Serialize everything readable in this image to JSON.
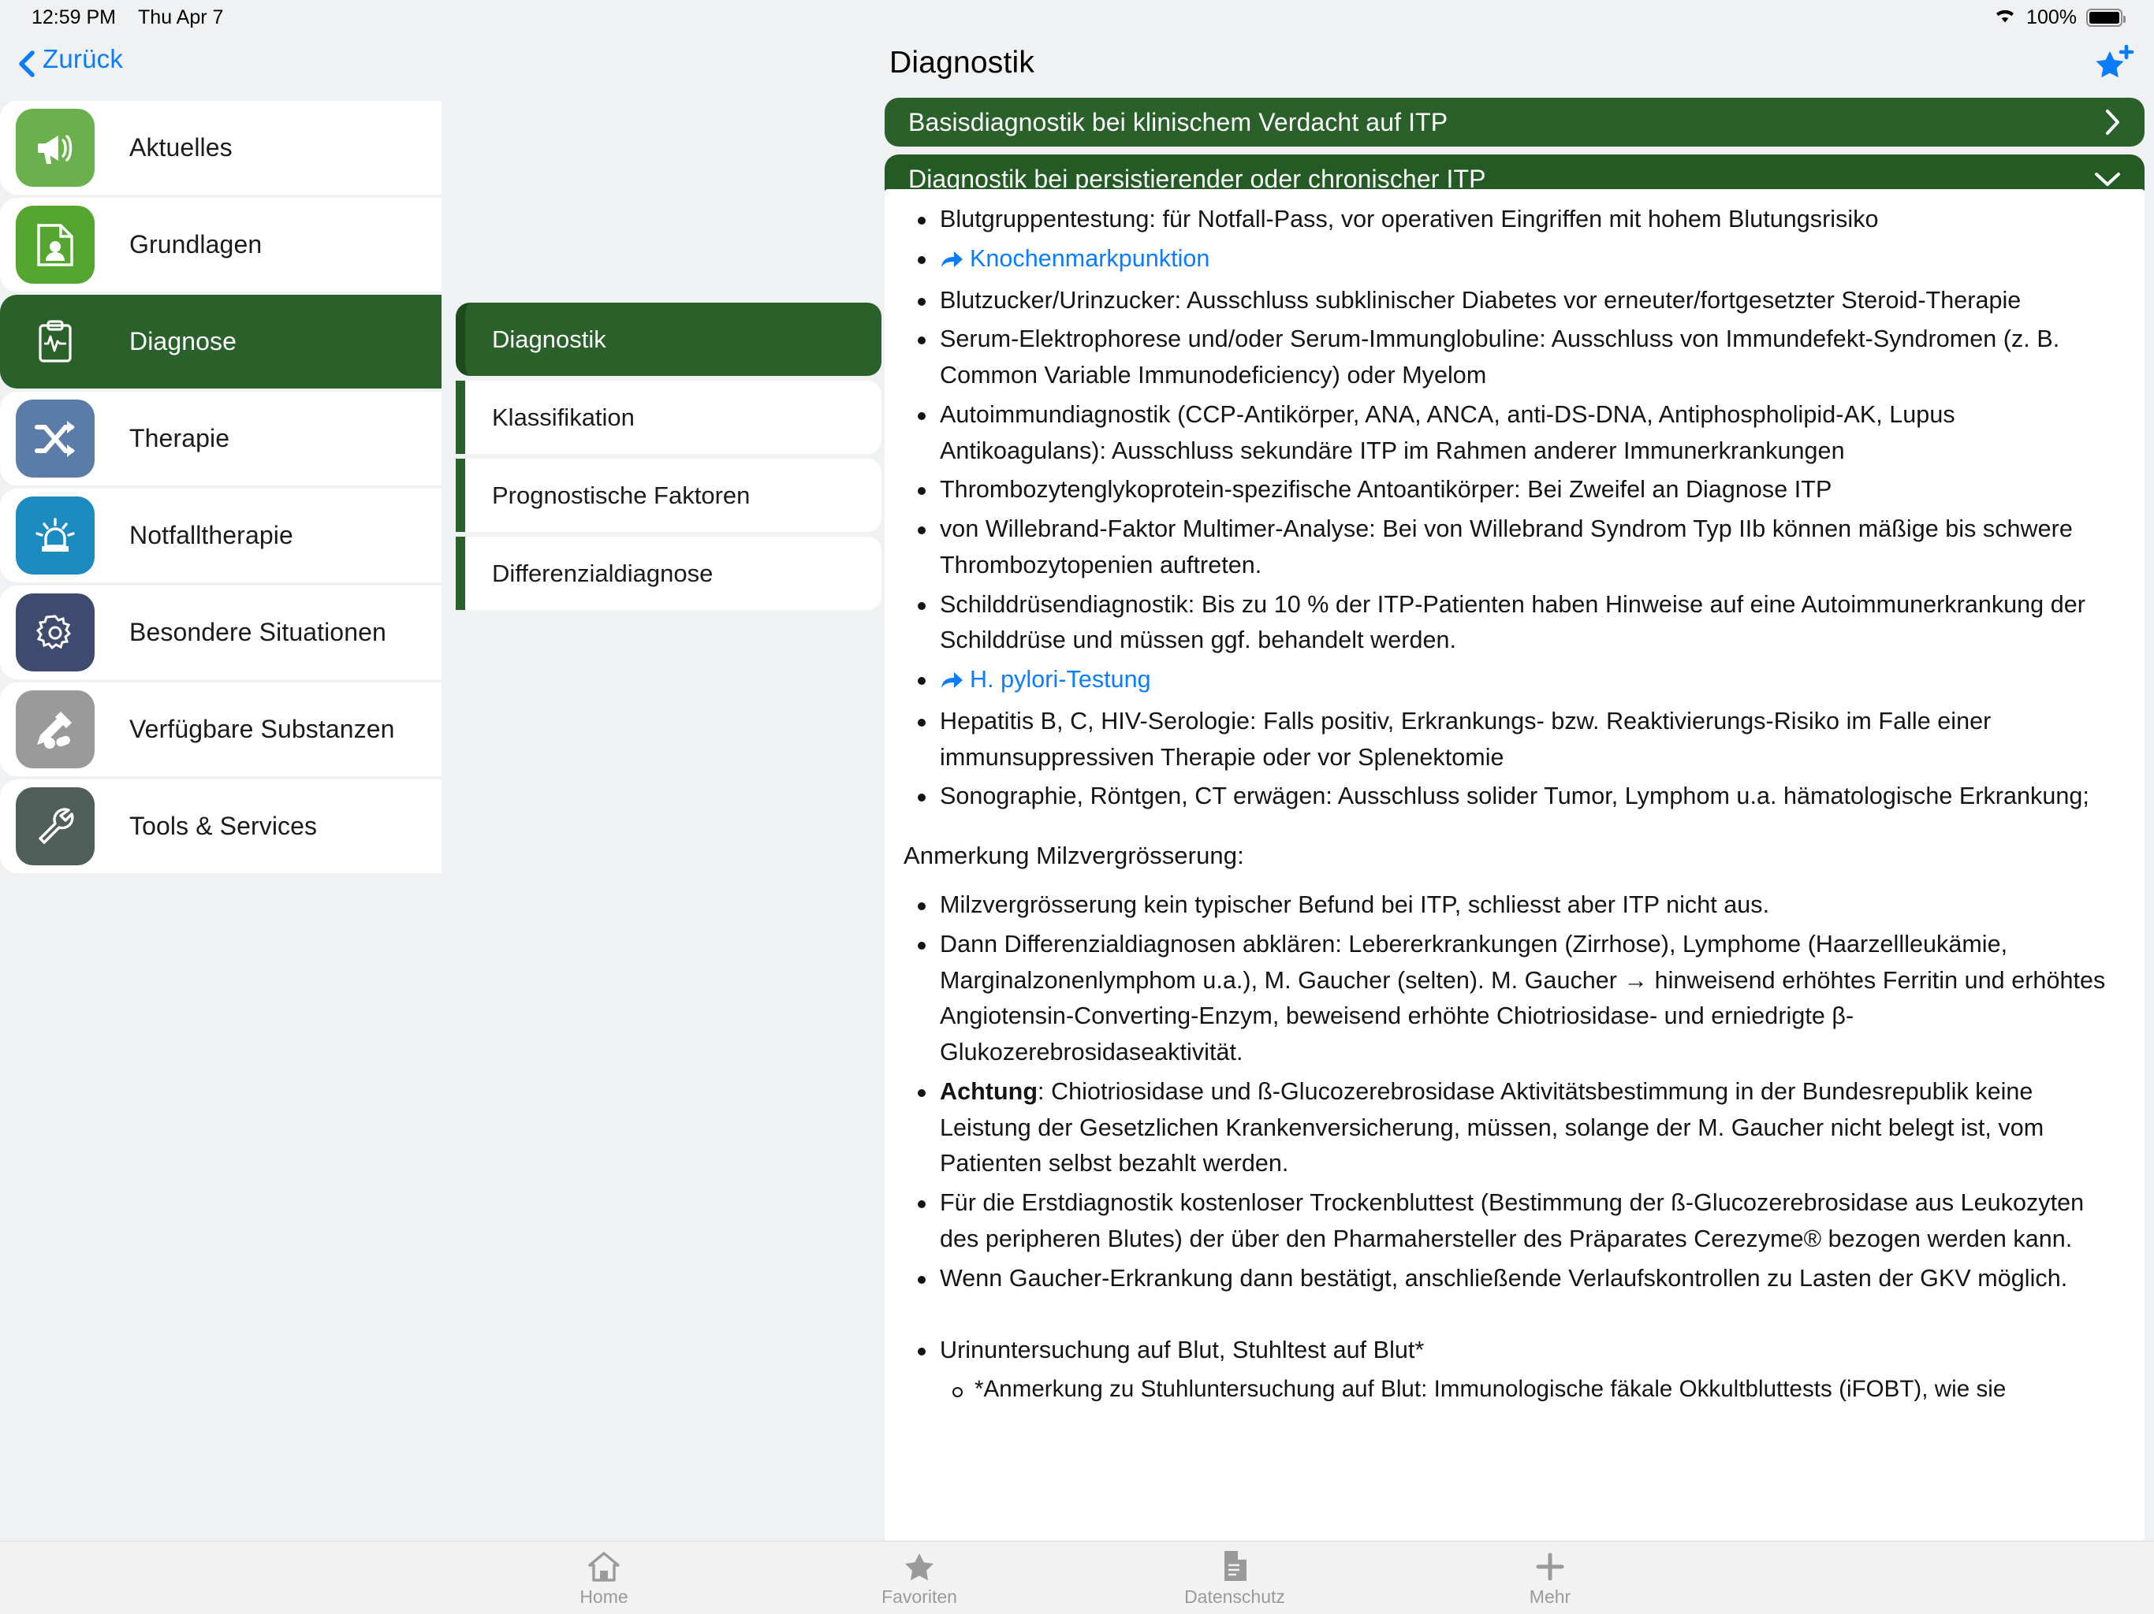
{
  "status_bar": {
    "time": "12:59 PM",
    "date": "Thu Apr 7",
    "battery_percent": "100%",
    "wifi_icon": "wifi-icon",
    "battery_icon": "battery-full-icon"
  },
  "nav": {
    "back_label": "Zurück",
    "back_icon": "chevron-left-icon"
  },
  "sidebar": {
    "items": [
      {
        "label": "Aktuelles",
        "icon": "megaphone-icon",
        "color": "#6ab04c",
        "selected": false
      },
      {
        "label": "Grundlagen",
        "icon": "document-person-icon",
        "color": "#55a630",
        "selected": false
      },
      {
        "label": "Diagnose",
        "icon": "clipboard-pulse-icon",
        "color": "#2a6029",
        "selected": true
      },
      {
        "label": "Therapie",
        "icon": "shuffle-icon",
        "color": "#5b7ca8",
        "selected": false
      },
      {
        "label": "Notfalltherapie",
        "icon": "siren-icon",
        "color": "#1b8bc0",
        "selected": false
      },
      {
        "label": "Besondere Situationen",
        "icon": "gear-icon",
        "color": "#3e4b6e",
        "selected": false
      },
      {
        "label": "Verfügbare Substanzen",
        "icon": "syringe-pills-icon",
        "color": "#9a9a9a",
        "selected": false
      },
      {
        "label": "Tools & Services",
        "icon": "wrench-icon",
        "color": "#4f5e58",
        "selected": false
      }
    ]
  },
  "submenu": {
    "items": [
      {
        "label": "Diagnostik",
        "selected": true
      },
      {
        "label": "Klassifikation",
        "selected": false
      },
      {
        "label": "Prognostische Faktoren",
        "selected": false
      },
      {
        "label": "Differenzialdiagnose",
        "selected": false
      }
    ]
  },
  "main": {
    "title": "Diagnostik",
    "favorite_icon": "star-plus-icon",
    "accent_color": "#2a6029",
    "link_color": "#0a7cff",
    "accordions": [
      {
        "label": "Basisdiagnostik bei klinischem Verdacht auf ITP",
        "state_icon": "chevron-right-icon",
        "expanded": false
      },
      {
        "label": "Diagnostik bei persistierender oder chronischer ITP",
        "state_icon": "chevron-down-icon",
        "expanded": true
      }
    ],
    "bullets": [
      {
        "text": "Blutgruppentestung: für Notfall-Pass, vor operativen Eingriffen mit hohem Blutungsrisiko",
        "link": false
      },
      {
        "text": "Knochenmarkpunktion",
        "link": true
      },
      {
        "text": "Blutzucker/Urinzucker: Ausschluss subklinischer Diabetes vor erneuter/fortgesetzter Steroid-Therapie",
        "link": false
      },
      {
        "text": "Serum-Elektrophorese und/oder Serum-Immunglobuline: Ausschluss von Immundefekt-Syndromen (z. B. Common Variable Immunodeficiency) oder Myelom",
        "link": false
      },
      {
        "text": "Autoimmundiagnostik (CCP-Antikörper, ANA, ANCA, anti-DS-DNA, Antiphospholipid-AK, Lupus Antikoagulans): Ausschluss sekundäre ITP im Rahmen anderer Immunerkrankungen",
        "link": false
      },
      {
        "text": "Thrombozytenglykoprotein-spezifische Antoantikörper: Bei Zweifel an Diagnose ITP",
        "link": false
      },
      {
        "text": "von Willebrand-Faktor Multimer-Analyse: Bei von Willebrand Syndrom Typ IIb können mäßige bis schwere Thrombozytopenien auftreten.",
        "link": false
      },
      {
        "text": "Schilddrüsendiagnostik: Bis zu 10 % der ITP-Patienten haben Hinweise auf eine Autoimmunerkrankung der Schilddrüse und müssen ggf. behandelt werden.",
        "link": false
      },
      {
        "text": "H. pylori-Testung",
        "link": true
      },
      {
        "text": "Hepatitis B, C, HIV-Serologie: Falls positiv, Erkrankungs- bzw. Reaktivierungs-Risiko im Falle einer immunsuppressiven Therapie oder vor Splenektomie",
        "link": false
      },
      {
        "text": "Sonographie, Röntgen, CT erwägen: Ausschluss solider Tumor, Lymphom u.a. hämatologische Erkrankung;",
        "link": false
      }
    ],
    "section_heading": "Anmerkung Milzvergrösserung:",
    "bullets2": [
      {
        "text": "Milzvergrösserung kein typischer Befund bei ITP, schliesst aber ITP nicht aus.",
        "bold_prefix": ""
      },
      {
        "text": "Dann Differenzialdiagnosen abklären: Lebererkrankungen (Zirrhose), Lymphome (Haarzellleukämie, Marginalzonenlymphom u.a.), M. Gaucher (selten). M. Gaucher → hinweisend erhöhtes Ferritin und erhöhtes Angiotensin-Converting-Enzym, beweisend erhöhte Chiotriosidase- und erniedrigte β-Glukozerebrosidaseaktivität.",
        "bold_prefix": ""
      },
      {
        "text": ": Chiotriosidase und ß-Glucozerebrosidase Aktivitätsbestimmung in der Bundesrepublik keine Leistung der Gesetzlichen Krankenversicherung, müssen, solange der M. Gaucher nicht belegt ist, vom Patienten selbst bezahlt werden.",
        "bold_prefix": "Achtung"
      },
      {
        "text": "Für die Erstdiagnostik kostenloser Trockenbluttest (Bestimmung der ß-Glucozerebrosidase aus Leukozyten des peripheren Blutes) der über den Pharmahersteller des Präparates Cerezyme® bezogen werden kann.",
        "bold_prefix": ""
      },
      {
        "text": "Wenn Gaucher-Erkrankung dann bestätigt, anschließende Verlaufskontrollen zu Lasten der GKV möglich.",
        "bold_prefix": ""
      }
    ],
    "bullets3": [
      {
        "text": "Urinuntersuchung auf Blut, Stuhltest auf Blut*",
        "sub": false
      },
      {
        "text": "*Anmerkung zu Stuhluntersuchung auf Blut: Immunologische fäkale Okkultbluttests (iFOBT), wie sie",
        "sub": true
      }
    ]
  },
  "tabbar": {
    "tabs": [
      {
        "label": "Home",
        "icon": "home-icon"
      },
      {
        "label": "Favoriten",
        "icon": "star-icon"
      },
      {
        "label": "Datenschutz",
        "icon": "document-icon"
      },
      {
        "label": "Mehr",
        "icon": "plus-icon"
      }
    ]
  }
}
